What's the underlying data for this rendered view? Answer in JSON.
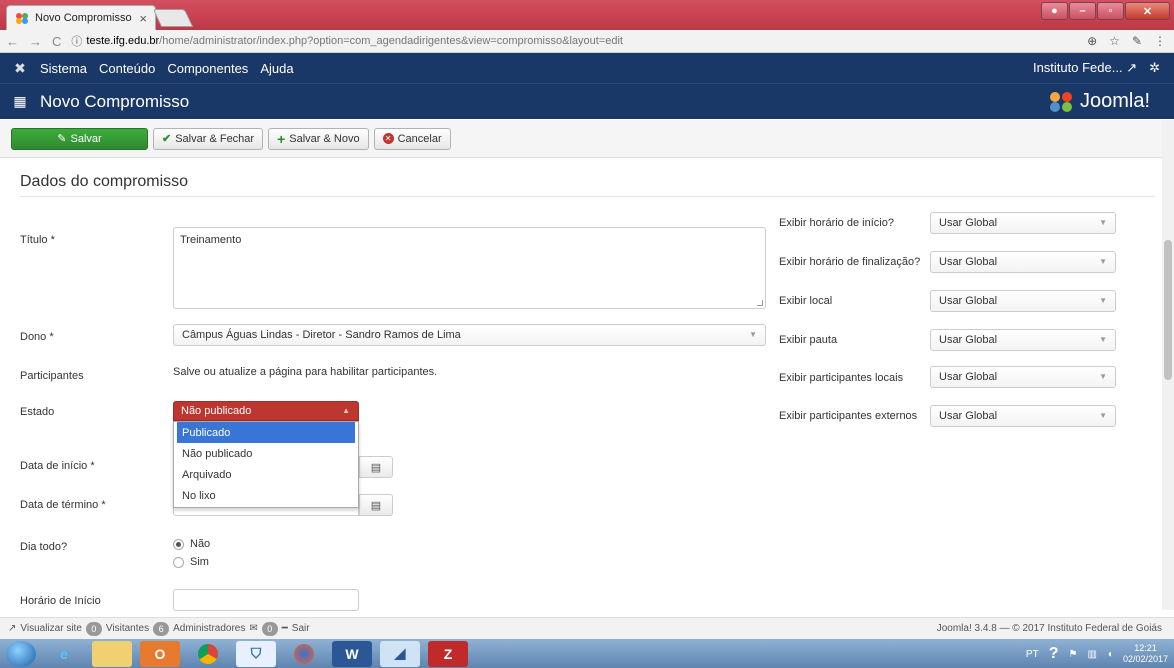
{
  "browser": {
    "tab_title": "Novo Compromisso",
    "url_host": "teste.ifg.edu.br",
    "url_path": "/home/administrator/index.php?option=com_agendadirigentes&view=compromisso&layout=edit"
  },
  "adminbar": {
    "menu": [
      "Sistema",
      "Conteúdo",
      "Componentes",
      "Ajuda"
    ],
    "user": "Instituto Fede..."
  },
  "header": {
    "title": "Novo Compromisso",
    "brand": "Joomla!"
  },
  "toolbar": {
    "save": "Salvar",
    "save_close": "Salvar & Fechar",
    "save_new": "Salvar & Novo",
    "cancel": "Cancelar"
  },
  "form": {
    "section_title": "Dados do compromisso",
    "titulo_label": "Título *",
    "titulo_value": "Treinamento",
    "dono_label": "Dono *",
    "dono_value": "Câmpus Águas Lindas - Diretor - Sandro Ramos de Lima",
    "participantes_label": "Participantes",
    "participantes_text": "Salve ou atualize a página para habilitar participantes.",
    "estado_label": "Estado",
    "estado_value": "Não publicado",
    "estado_options": [
      "Publicado",
      "Não publicado",
      "Arquivado",
      "No lixo"
    ],
    "data_inicio_label": "Data de início *",
    "data_termino_label": "Data de término *",
    "dia_todo_label": "Dia todo?",
    "dia_todo_options": [
      "Não",
      "Sim"
    ],
    "horario_inicio_label": "Horário de Início"
  },
  "options": [
    {
      "label": "Exibir horário de início?",
      "value": "Usar Global"
    },
    {
      "label": "Exibir horário de finalização?",
      "value": "Usar Global"
    },
    {
      "label": "Exibir local",
      "value": "Usar Global"
    },
    {
      "label": "Exibir pauta",
      "value": "Usar Global"
    },
    {
      "label": "Exibir participantes locais",
      "value": "Usar Global"
    },
    {
      "label": "Exibir participantes externos",
      "value": "Usar Global"
    }
  ],
  "statusbar": {
    "view_site": "Visualizar site",
    "visitors_count": "0",
    "visitors": "Visitantes",
    "admins_count": "6",
    "admins": "Administradores",
    "messages_count": "0",
    "logout": "Sair",
    "footer": "Joomla! 3.4.8 — © 2017 Instituto Federal de Goiás"
  },
  "taskbar": {
    "lang": "PT",
    "time": "12:21",
    "date": "02/02/2017"
  },
  "colors": {
    "navbar": "#1a3867",
    "save_green": "#2f8a2f",
    "status_red": "#bd362f",
    "selected_blue": "#3875d7"
  }
}
